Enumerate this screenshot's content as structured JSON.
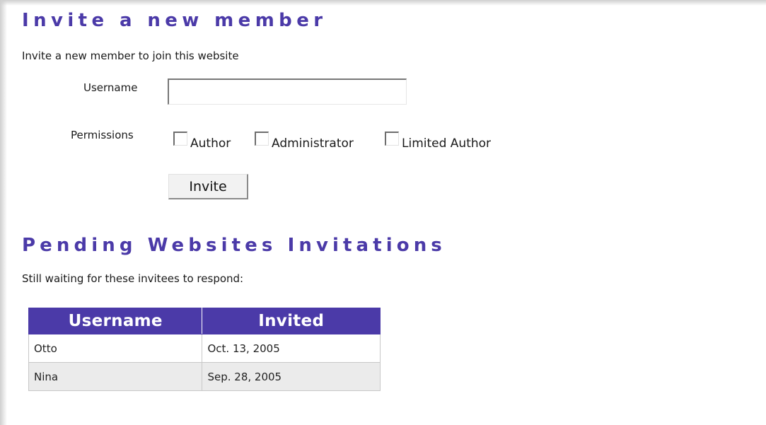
{
  "invite_section": {
    "title": "Invite a new member",
    "description": "Invite a new member to join this website",
    "username_label": "Username",
    "username_value": "",
    "permissions_label": "Permissions",
    "permissions": [
      {
        "label": "Author",
        "checked": false
      },
      {
        "label": "Administrator",
        "checked": false
      },
      {
        "label": "Limited Author",
        "checked": false
      }
    ],
    "invite_button": "Invite"
  },
  "pending_section": {
    "title": "Pending Websites Invitations",
    "description": "Still waiting for these invitees to respond:",
    "table": {
      "headers": [
        "Username",
        "Invited"
      ],
      "rows": [
        [
          "Otto",
          "Oct. 13, 2005"
        ],
        [
          "Nina",
          "Sep. 28, 2005"
        ]
      ]
    }
  },
  "colors": {
    "accent": "#4b3aa8",
    "row_alt": "#ebebeb"
  }
}
